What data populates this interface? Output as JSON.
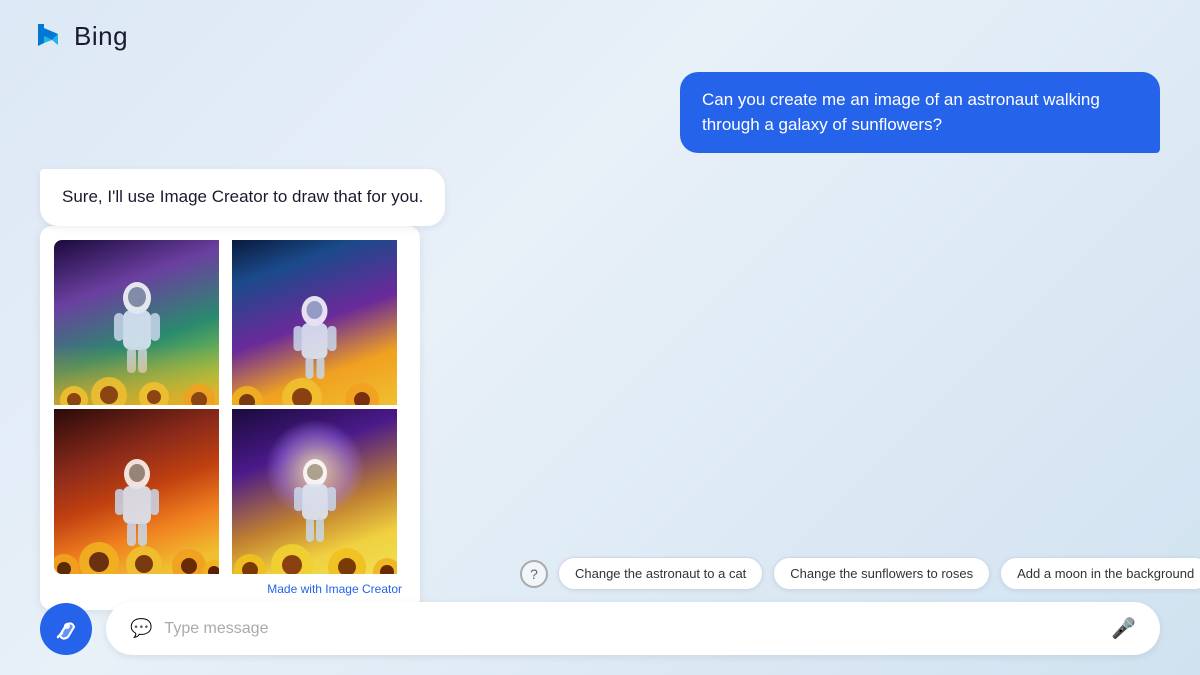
{
  "header": {
    "logo_text": "Bing"
  },
  "user_message": {
    "text": "Can you create me an image of an astronaut walking through a galaxy of sunflowers?"
  },
  "bot_message": {
    "text": "Sure, I'll use Image Creator to draw that for you."
  },
  "image_grid": {
    "made_with_text": "Made with ",
    "made_with_link": "Image Creator"
  },
  "suggestions": {
    "help_label": "?",
    "chips": [
      {
        "label": "Change the astronaut to a cat"
      },
      {
        "label": "Change the sunflowers to roses"
      },
      {
        "label": "Add a moon in the background"
      }
    ]
  },
  "input": {
    "placeholder": "Type message"
  }
}
